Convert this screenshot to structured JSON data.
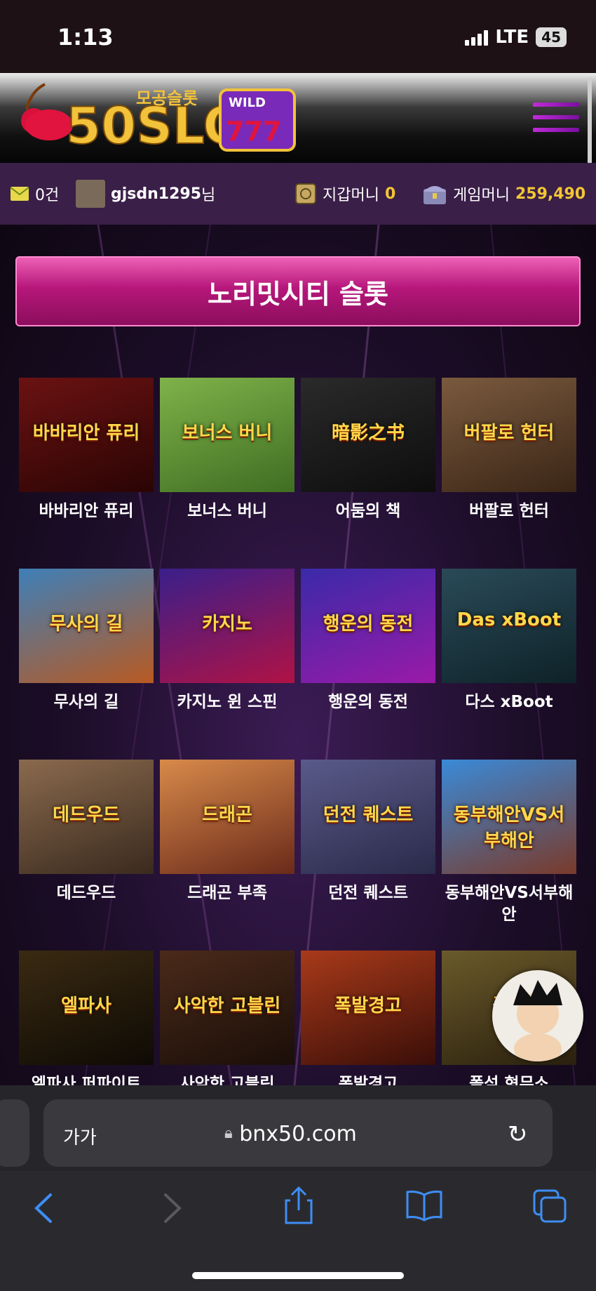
{
  "status": {
    "time": "1:13",
    "carrier": "LTE",
    "battery": "45"
  },
  "header": {
    "logo_main": "50SLOT",
    "logo_sub": "모공슬롯",
    "logo_badge": "WILD",
    "logo_reels": "777"
  },
  "userbar": {
    "messages": "0건",
    "username": "gjsdn1295",
    "suffix": "님",
    "wallet_label": "지갑머니",
    "wallet_value": "0",
    "game_label": "게임머니",
    "game_value": "259,490"
  },
  "title": "노리밋시티 슬롯",
  "games": [
    {
      "name": "바바리안 퓨리",
      "thumb": "바바리안 퓨리",
      "bg": "#6b1212",
      "bg2": "#2a0404"
    },
    {
      "name": "보너스 버니",
      "thumb": "보너스 버니",
      "bg": "#7fb24a",
      "bg2": "#3f6e22"
    },
    {
      "name": "어둠의 책",
      "thumb": "暗影之书",
      "bg": "#2a2a2a",
      "bg2": "#0d0d0d"
    },
    {
      "name": "버팔로 헌터",
      "thumb": "버팔로 헌터",
      "bg": "#7a5a3e",
      "bg2": "#3a2516"
    },
    {
      "name": "무사의 길",
      "thumb": "무사의 길",
      "bg": "#3e7fb8",
      "bg2": "#b85a22"
    },
    {
      "name": "카지노 윈 스핀",
      "thumb": "카지노",
      "bg": "#3a1f8a",
      "bg2": "#b01245"
    },
    {
      "name": "행운의 동전",
      "thumb": "행운의 동전",
      "bg": "#3a2aa8",
      "bg2": "#9a1aa8"
    },
    {
      "name": "다스 xBoot",
      "thumb": "Das xBoot",
      "bg": "#2a4a58",
      "bg2": "#0e2228"
    },
    {
      "name": "데드우드",
      "thumb": "데드우드",
      "bg": "#8a6a4e",
      "bg2": "#3a2a1e"
    },
    {
      "name": "드래곤 부족",
      "thumb": "드래곤",
      "bg": "#d88a4a",
      "bg2": "#6a2a1a"
    },
    {
      "name": "던전 퀘스트",
      "thumb": "던전 퀘스트",
      "bg": "#5a5a8a",
      "bg2": "#2a2a4a"
    },
    {
      "name": "동부해안VS서부해안",
      "thumb": "동부해안VS서부해안",
      "bg": "#3a8ad8",
      "bg2": "#7a3a2a"
    },
    {
      "name": "엘파사 퍼파이트",
      "thumb": "엘파사",
      "bg": "#3a2a12",
      "bg2": "#0e0a04"
    },
    {
      "name": "사악한 고블린",
      "thumb": "사악한 고블린",
      "bg": "#4a2a1a",
      "bg2": "#1a0e08"
    },
    {
      "name": "폭발경고",
      "thumb": "폭발경고",
      "bg": "#a83a1a",
      "bg2": "#3a0e08"
    },
    {
      "name": "폴섬 형무소",
      "thumb": "폴섬",
      "bg": "#6a5a2a",
      "bg2": "#2a200e"
    }
  ],
  "browser": {
    "aa": "가가",
    "url": "bnx50.com"
  }
}
